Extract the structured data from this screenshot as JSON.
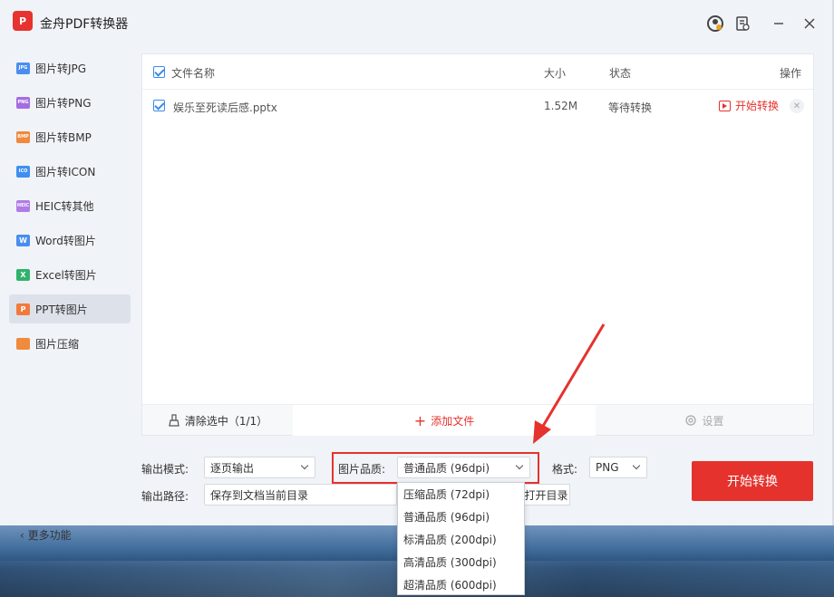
{
  "app": {
    "title": "金舟PDF转换器",
    "logo_text": "P"
  },
  "titlebar": {
    "icons": [
      "avatar-icon",
      "feedback-icon",
      "minimize-icon",
      "close-icon"
    ]
  },
  "sidebar": {
    "items": [
      {
        "label": "图片转JPG",
        "icon": "jpg-icon",
        "badge": "JPG",
        "color": "#4a8df0"
      },
      {
        "label": "图片转PNG",
        "icon": "png-icon",
        "badge": "PNG",
        "color": "#a46ee0"
      },
      {
        "label": "图片转BMP",
        "icon": "bmp-icon",
        "badge": "BMP",
        "color": "#f08a3c"
      },
      {
        "label": "图片转ICON",
        "icon": "ico-icon",
        "badge": "ICO",
        "color": "#3f8ff0"
      },
      {
        "label": "HEIC转其他",
        "icon": "heic-icon",
        "badge": "HEIC",
        "color": "#b07be8"
      },
      {
        "label": "Word转图片",
        "icon": "word-icon",
        "badge": "W",
        "color": "#4a8df0"
      },
      {
        "label": "Excel转图片",
        "icon": "excel-icon",
        "badge": "X",
        "color": "#2fb36b"
      },
      {
        "label": "PPT转图片",
        "icon": "ppt-icon",
        "badge": "P",
        "color": "#f07a3c"
      },
      {
        "label": "图片压缩",
        "icon": "compress-icon",
        "badge": "",
        "color": "#f08a3c"
      }
    ],
    "active_index": 7,
    "more": "更多功能"
  },
  "table": {
    "headers": {
      "name": "文件名称",
      "size": "大小",
      "status": "状态",
      "action": "操作"
    },
    "rows": [
      {
        "name": "娱乐至死读后感.pptx",
        "size": "1.52M",
        "status": "等待转换",
        "action": "开始转换"
      }
    ],
    "footer": {
      "clear": "清除选中（1/1）",
      "add": "添加文件",
      "settings": "设置"
    }
  },
  "controls": {
    "output_mode_label": "输出模式:",
    "output_mode_value": "逐页输出",
    "quality_label": "图片品质:",
    "quality_value": "普通品质 (96dpi)",
    "format_label": "格式:",
    "format_value": "PNG",
    "path_label": "输出路径:",
    "path_value": "保存到文档当前目录",
    "open_dir": "打开目录",
    "start": "开始转换"
  },
  "dropdown": {
    "options": [
      "压缩品质 (72dpi)",
      "普通品质 (96dpi)",
      "标清品质 (200dpi)",
      "高清品质 (300dpi)",
      "超清品质 (600dpi)"
    ]
  },
  "colors": {
    "accent": "#e5322d",
    "check": "#3a8be8",
    "annotation": "#e5322d"
  }
}
